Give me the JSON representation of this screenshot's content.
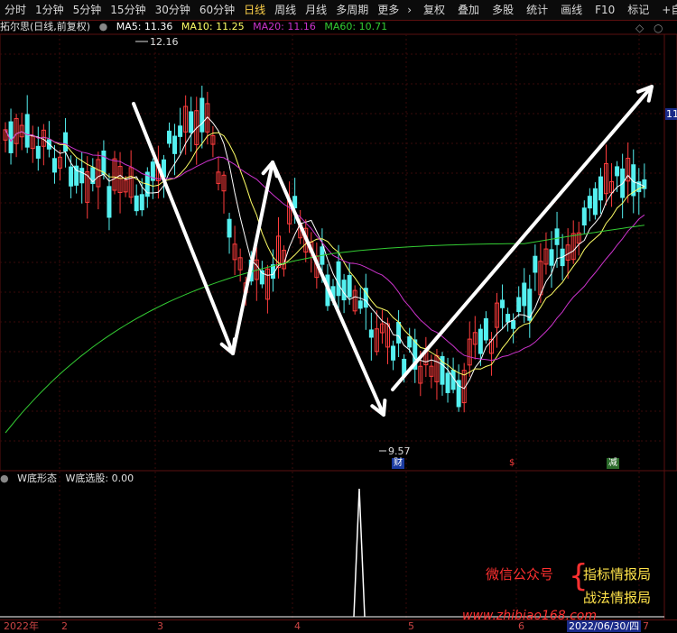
{
  "toolbar": {
    "periods": [
      "分时",
      "1分钟",
      "5分钟",
      "15分钟",
      "30分钟",
      "60分钟",
      "日线",
      "周线",
      "月线",
      "多周期",
      "更多"
    ],
    "active_index": 6,
    "tools": [
      "复权",
      "叠加",
      "多股",
      "统计",
      "画线",
      "F10",
      "标记",
      "+自选"
    ]
  },
  "main_panel": {
    "title": "拓尔思(日线,前复权)",
    "ma5": "MA5: 11.36",
    "ma10": "MA10: 11.25",
    "ma20": "MA20: 11.16",
    "ma60": "MA60: 10.71",
    "high_label": "12.16",
    "low_label": "9.57",
    "right_edge_label": "11",
    "markers": [
      "财",
      "$",
      "减"
    ]
  },
  "sub_panel": {
    "title": "W底形态",
    "value_label": "W底选股: 0.00"
  },
  "xaxis": {
    "labels": [
      "2022年",
      "2",
      "3",
      "4",
      "5",
      "6",
      "7"
    ],
    "current_date": "2022/06/30/四"
  },
  "watermark": {
    "wechat": "微信公众号",
    "brand1": "指标情报局",
    "brand2": "战法情报局",
    "url": "www.zhibiao168.com"
  },
  "colors": {
    "up": "#ff3c3c",
    "down": "#54f0f0",
    "ma5": "#ffffff",
    "ma10": "#ffff66",
    "ma20": "#cc33cc",
    "ma60": "#33cc33",
    "arrow": "#ffffff",
    "grid": "#5a1010"
  }
}
